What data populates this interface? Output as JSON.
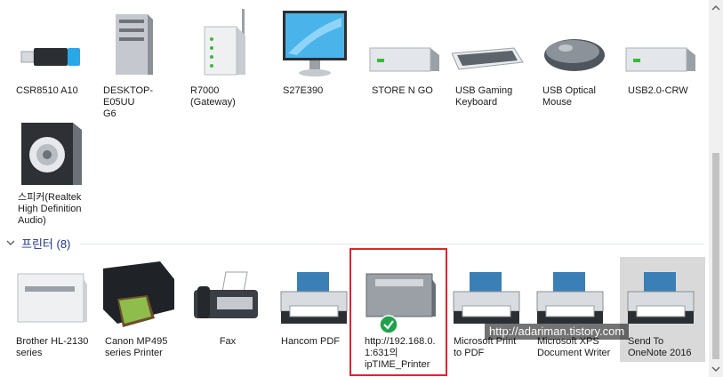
{
  "devices": [
    {
      "label": "CSR8510 A10",
      "icon": "bluetooth-dongle-icon"
    },
    {
      "label": "DESKTOP-E05UU\nG6",
      "icon": "desktop-tower-icon"
    },
    {
      "label": "R7000 (Gateway)",
      "icon": "router-icon"
    },
    {
      "label": "S27E390",
      "icon": "monitor-icon"
    },
    {
      "label": "STORE N GO",
      "icon": "usb-drive-icon"
    },
    {
      "label": "USB Gaming\nKeyboard",
      "icon": "keyboard-icon"
    },
    {
      "label": "USB Optical\nMouse",
      "icon": "mouse-icon"
    },
    {
      "label": "USB2.0-CRW",
      "icon": "card-reader-icon"
    },
    {
      "label": "스피커(Realtek\nHigh Definition\nAudio)",
      "icon": "speaker-icon"
    }
  ],
  "printers_group": {
    "title": "프린터 (8)"
  },
  "printers": [
    {
      "label": "Brother HL-2130\nseries",
      "icon": "laser-printer-icon"
    },
    {
      "label": "Canon MP495\nseries Printer",
      "icon": "inkjet-printer-icon"
    },
    {
      "label": "Fax",
      "icon": "fax-icon"
    },
    {
      "label": "Hancom PDF",
      "icon": "virtual-printer-icon"
    },
    {
      "label": "http://192.168.0.\n1:631의\nipTIME_Printer",
      "icon": "default-laser-printer-icon"
    },
    {
      "label": "Microsoft Print\nto PDF",
      "icon": "virtual-printer-icon"
    },
    {
      "label": "Microsoft XPS\nDocument Writer",
      "icon": "virtual-printer-icon"
    },
    {
      "label": "Send To\nOneNote 2016",
      "icon": "virtual-printer-icon"
    }
  ],
  "watermark": "http://adariman.tistory.com",
  "colors": {
    "group_header": "#1e3287",
    "highlight": "#e0242c",
    "selected": "#d9d9d9"
  }
}
